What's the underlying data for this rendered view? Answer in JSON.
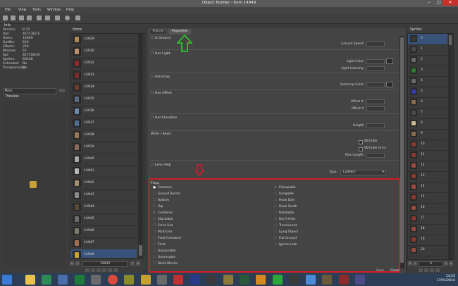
{
  "window": {
    "title": "Object Builder - Item 14949",
    "min": "–",
    "max": "□",
    "close": "✕"
  },
  "menu": [
    "File",
    "View",
    "Tools",
    "Window",
    "Help"
  ],
  "info": {
    "header": "Info",
    "rows": [
      {
        "k": "Version:",
        "v": "8.70"
      },
      {
        "k": "Dat:",
        "v": "4E7C3DCE"
      },
      {
        "k": "Items:",
        "v": "14949"
      },
      {
        "k": "Outfits:",
        "v": "510"
      },
      {
        "k": "Effects:",
        "v": "256"
      },
      {
        "k": "Missiles:",
        "v": "67"
      },
      {
        "k": "Spr:",
        "v": "4E7C0DAA"
      },
      {
        "k": "Sprites:",
        "v": "60536"
      },
      {
        "k": "Extended:",
        "v": "No"
      },
      {
        "k": "Transparency:",
        "v": "No"
      }
    ],
    "selector": "Item",
    "preview_label": "Preview"
  },
  "items": {
    "header": "Items",
    "list": [
      {
        "id": "14929",
        "color": "#b08a55"
      },
      {
        "id": "14930",
        "color": "#b89070"
      },
      {
        "id": "14932",
        "color": "#8a2b2b"
      },
      {
        "id": "14933",
        "color": "#7a2a2a"
      },
      {
        "id": "14934",
        "color": "#6b3a2a"
      },
      {
        "id": "14935",
        "color": "#5b6b88"
      },
      {
        "id": "14936",
        "color": "#6a88a8"
      },
      {
        "id": "14937",
        "color": "#4e6f8f"
      },
      {
        "id": "14938",
        "color": "#9a7a55"
      },
      {
        "id": "14939",
        "color": "#8a6a5a"
      },
      {
        "id": "14940",
        "color": "#a8a8a8"
      },
      {
        "id": "14941",
        "color": "#b7b7b7"
      },
      {
        "id": "14942",
        "color": "#a09070"
      },
      {
        "id": "14943",
        "color": "#8a8a8a"
      },
      {
        "id": "14944",
        "color": "#5a4a3a"
      },
      {
        "id": "14945",
        "color": "#6a6a6a"
      },
      {
        "id": "14946",
        "color": "#7a7a6a"
      },
      {
        "id": "14947",
        "color": "#a07050"
      },
      {
        "id": "14948",
        "color": "#8a8a8a"
      },
      {
        "id": "14949",
        "color": "#c9a237"
      }
    ],
    "page_value": "14949"
  },
  "properties": {
    "tabs": [
      "Texture",
      "Properties"
    ],
    "sections": {
      "is_ground": "Is Ground",
      "ground_speed": "Ground Speed:",
      "has_light": "Has Light",
      "light_color": "Light Color:",
      "light_intensity": "Light Intensity:",
      "automap": "Automap",
      "automap_color": "Automap Color:",
      "has_offset": "Has Offset",
      "offset_x": "Offset X:",
      "offset_y": "Offset Y:",
      "has_elevation": "Has Elevation",
      "height": "Height:",
      "write_read": "Write / Read",
      "writable": "Writable",
      "writable_once": "Writable Once",
      "max_length": "Max Length:",
      "lens_help": "Lens Help",
      "type_label": "Type:",
      "type_value": "Ladders"
    },
    "flags_header": "Flags",
    "flags_left": [
      {
        "label": "Common",
        "state": "radio"
      },
      {
        "label": "Ground Border",
        "state": "off"
      },
      {
        "label": "Bottom",
        "state": "off"
      },
      {
        "label": "Top",
        "state": "off"
      },
      {
        "label": "Container",
        "state": "on"
      },
      {
        "label": "Stackable",
        "state": "off"
      },
      {
        "label": "Force Use",
        "state": "off"
      },
      {
        "label": "Multi Use",
        "state": "off"
      },
      {
        "label": "Fluid Container",
        "state": "off"
      },
      {
        "label": "Fluid",
        "state": "off"
      },
      {
        "label": "Unpassable",
        "state": "off"
      },
      {
        "label": "Unmovable",
        "state": "off"
      },
      {
        "label": "Block Missile",
        "state": "off"
      }
    ],
    "flags_right": [
      {
        "label": "Pickupable",
        "state": "on"
      },
      {
        "label": "Hangable",
        "state": "off"
      },
      {
        "label": "Hook East",
        "state": "off"
      },
      {
        "label": "Hook South",
        "state": "off"
      },
      {
        "label": "Rotatable",
        "state": "off"
      },
      {
        "label": "Don't Hide",
        "state": "off"
      },
      {
        "label": "Translucent",
        "state": "off"
      },
      {
        "label": "Lying Object",
        "state": "off"
      },
      {
        "label": "Full Ground",
        "state": "off"
      },
      {
        "label": "Ignore Look",
        "state": "off"
      }
    ],
    "buttons": {
      "save": "Save",
      "close": "Close"
    }
  },
  "sprites": {
    "header": "Sprites",
    "list": [
      {
        "id": "0",
        "color": "#3a3a3a"
      },
      {
        "id": "1",
        "color": "#4a4a4a"
      },
      {
        "id": "2",
        "color": "#6a6a6a"
      },
      {
        "id": "3",
        "color": "#2e7a2e"
      },
      {
        "id": "4",
        "color": "#6a6a6a"
      },
      {
        "id": "5",
        "color": "#3a3ab0"
      },
      {
        "id": "6",
        "color": "#8a6a4a"
      },
      {
        "id": "7",
        "color": "#4a4a4a"
      },
      {
        "id": "8",
        "color": "#c8b890"
      },
      {
        "id": "9",
        "color": "#8a6a4a"
      },
      {
        "id": "10",
        "color": "#8a3a2a"
      },
      {
        "id": "11",
        "color": "#8a3a2a"
      },
      {
        "id": "12",
        "color": "#9a4a3a"
      },
      {
        "id": "13",
        "color": "#8a3a2a"
      },
      {
        "id": "14",
        "color": "#9a4a3a"
      },
      {
        "id": "15",
        "color": "#8a3a2a"
      },
      {
        "id": "16",
        "color": "#9a4a3a"
      },
      {
        "id": "17",
        "color": "#8a3a2a"
      },
      {
        "id": "18",
        "color": "#9a4a3a"
      },
      {
        "id": "19",
        "color": "#8a3a2a"
      },
      {
        "id": "20",
        "color": "#9a4a3a"
      }
    ],
    "page_value": "0"
  },
  "taskbar": {
    "time": "14:55",
    "date": "17/01/2016"
  },
  "colors": {
    "accent": "#38527a",
    "highlight": "#d21b2a",
    "arrow_green": "#2fb82f"
  }
}
